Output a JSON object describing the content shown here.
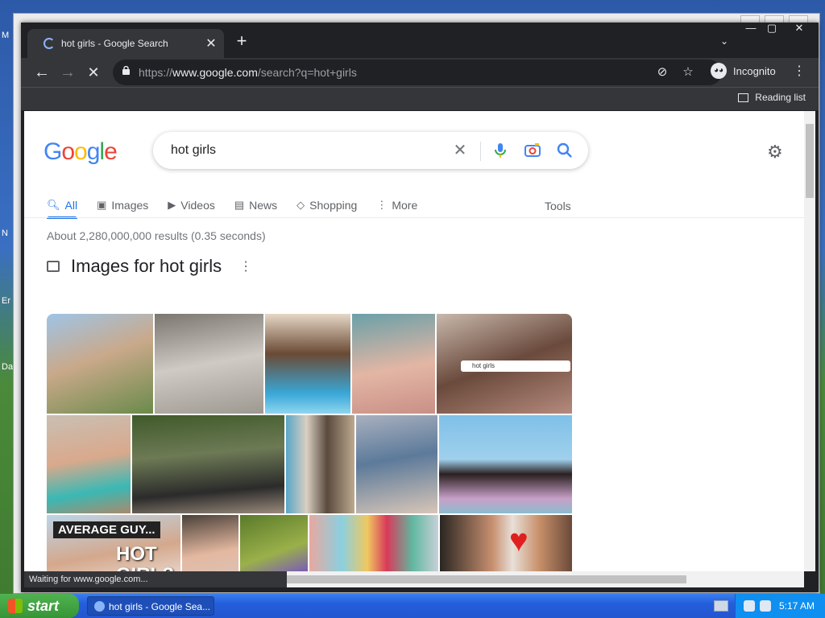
{
  "browser": {
    "tab_title": "hot girls - Google Search",
    "url_scheme": "https://",
    "url_host": "www.google.com",
    "url_path": "/search?q=hot+girls",
    "profile_label": "Incognito",
    "reading_list_label": "Reading list",
    "status_text": "Waiting for www.google.com..."
  },
  "google": {
    "logo_letters": [
      "G",
      "o",
      "o",
      "g",
      "l",
      "e"
    ],
    "logo_colors": [
      "#4285f4",
      "#ea4335",
      "#fbbc05",
      "#4285f4",
      "#34a853",
      "#ea4335"
    ],
    "query": "hot girls",
    "tabs": [
      {
        "label": "All",
        "icon": "search-icon",
        "active": true
      },
      {
        "label": "Images",
        "icon": "image-icon"
      },
      {
        "label": "Videos",
        "icon": "video-icon"
      },
      {
        "label": "News",
        "icon": "news-icon"
      },
      {
        "label": "Shopping",
        "icon": "tag-icon"
      },
      {
        "label": "More",
        "icon": "dots-icon"
      }
    ],
    "tools_label": "Tools",
    "result_stats": "About 2,280,000,000 results (0.35 seconds)",
    "images_heading": "Images for hot girls",
    "thumb_caption": "hot girls",
    "thumb_text_top": "AVERAGE GUY...",
    "thumb_text_big": "HOT GIRL?"
  },
  "taskbar": {
    "start_label": "start",
    "window_label": "hot girls - Google Sea...",
    "clock": "5:17 AM"
  },
  "desktop": {
    "labels": [
      "M",
      "N",
      "Er",
      "Da"
    ]
  },
  "colors": {
    "accent": "#1a73e8",
    "chrome_dark": "#202124",
    "toolbar": "#35363a"
  }
}
